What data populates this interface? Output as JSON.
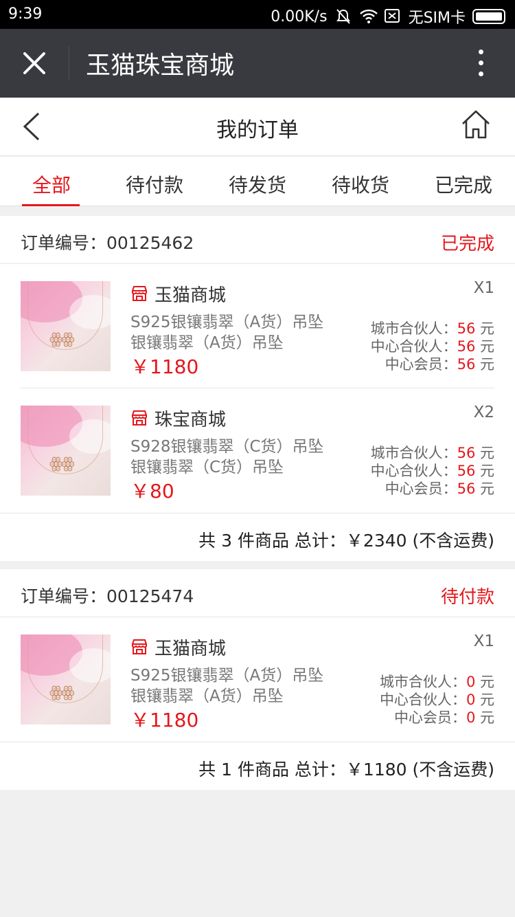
{
  "status_bar": {
    "time": "9:39",
    "speed": "0.00K/s",
    "sim": "无SIM卡"
  },
  "wechat_bar": {
    "title": "玉猫珠宝商城"
  },
  "nav": {
    "title": "我的订单"
  },
  "tabs": [
    {
      "label": "全部",
      "active": true
    },
    {
      "label": "待付款",
      "active": false
    },
    {
      "label": "待发货",
      "active": false
    },
    {
      "label": "待收货",
      "active": false
    },
    {
      "label": "已完成",
      "active": false
    }
  ],
  "orders": [
    {
      "number_label": "订单编号：00125462",
      "status": "已完成",
      "items": [
        {
          "store": "玉猫商城",
          "name_line1": "S925银镶翡翠（A货）吊坠",
          "name_line2": "银镶翡翠（A货）吊坠",
          "price": "￥1180",
          "qty": "X1",
          "commissions": [
            {
              "label": "城市合伙人：",
              "value": "56",
              "unit": "元"
            },
            {
              "label": "中心合伙人：",
              "value": "56",
              "unit": "元"
            },
            {
              "label": "中心会员：",
              "value": "56",
              "unit": "元"
            }
          ]
        },
        {
          "store": "珠宝商城",
          "name_line1": "S928银镶翡翠（C货）吊坠",
          "name_line2": "银镶翡翠（C货）吊坠",
          "price": "￥80",
          "qty": "X2",
          "commissions": [
            {
              "label": "城市合伙人：",
              "value": "56",
              "unit": "元"
            },
            {
              "label": "中心合伙人：",
              "value": "56",
              "unit": "元"
            },
            {
              "label": "中心会员：",
              "value": "56",
              "unit": "元"
            }
          ]
        }
      ],
      "total": "共 3 件商品  总计：￥2340 (不含运费)"
    },
    {
      "number_label": "订单编号：00125474",
      "status": "待付款",
      "items": [
        {
          "store": "玉猫商城",
          "name_line1": "S925银镶翡翠（A货）吊坠",
          "name_line2": "银镶翡翠（A货）吊坠",
          "price": "￥1180",
          "qty": "X1",
          "commissions": [
            {
              "label": "城市合伙人：",
              "value": "0",
              "unit": "元"
            },
            {
              "label": "中心合伙人：",
              "value": "0",
              "unit": "元"
            },
            {
              "label": "中心会员：",
              "value": "0",
              "unit": "元"
            }
          ]
        }
      ],
      "total": "共 1 件商品  总计：￥1180 (不含运费)"
    }
  ],
  "colors": {
    "accent": "#e5161b",
    "wechat_bar": "#393a3f",
    "page_bg": "#f0f0f0"
  }
}
